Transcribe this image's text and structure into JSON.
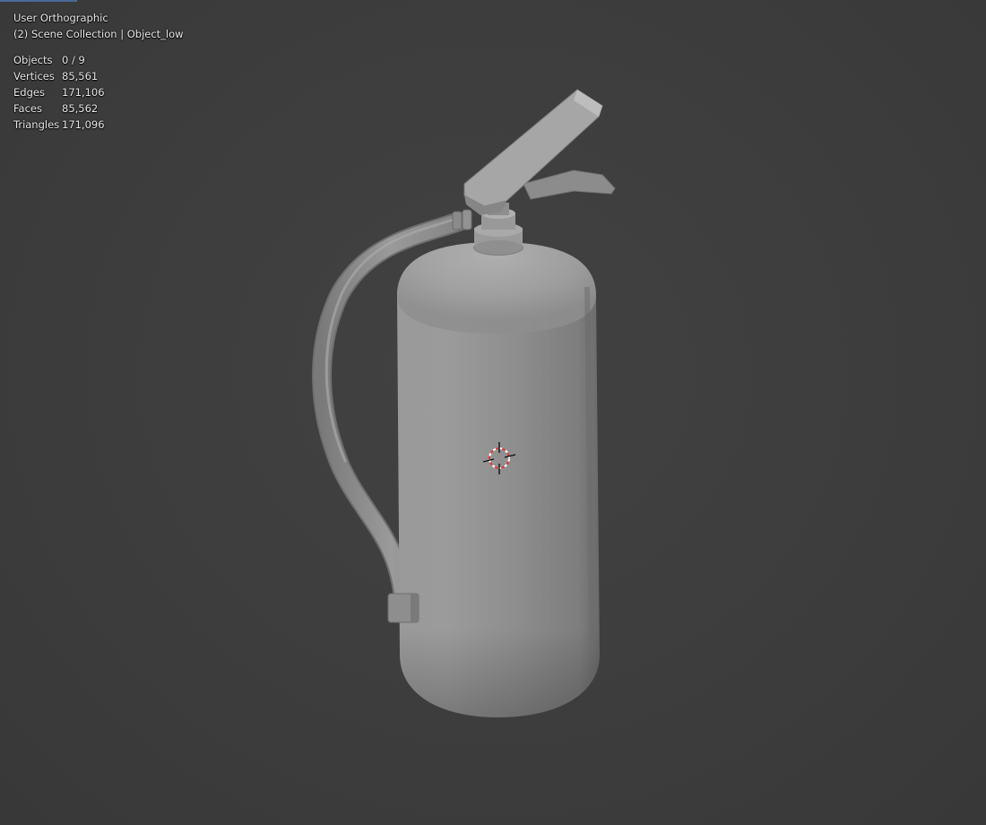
{
  "viewport": {
    "view_name": "User Orthographic",
    "collection_info": "(2) Scene Collection | Object_low",
    "stats": [
      {
        "label": "Objects",
        "value": "0 / 9"
      },
      {
        "label": "Vertices",
        "value": "85,561"
      },
      {
        "label": "Edges",
        "value": "171,106"
      },
      {
        "label": "Faces",
        "value": "85,562"
      },
      {
        "label": "Triangles",
        "value": "171,096"
      }
    ]
  },
  "colors": {
    "background": "#3d3d3d",
    "model_base": "#8f8f8f",
    "cursor_red": "#d83a3a"
  }
}
